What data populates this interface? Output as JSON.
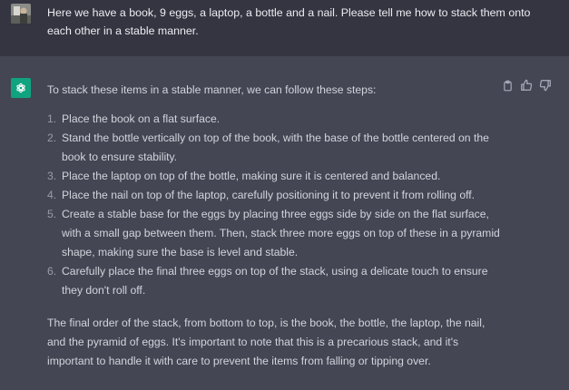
{
  "user": {
    "avatar_icon": "user-photo-avatar",
    "message": "Here we have a book, 9 eggs, a laptop, a bottle and a nail. Please tell me how to stack them onto each other in a stable manner."
  },
  "assistant": {
    "avatar_icon": "openai-logo-icon",
    "accent_color": "#10a37f",
    "intro": "To stack these items in a stable manner, we can follow these steps:",
    "steps": [
      {
        "num": "1.",
        "text": "Place the book on a flat surface."
      },
      {
        "num": "2.",
        "text": "Stand the bottle vertically on top of the book, with the base of the bottle centered on the book to ensure stability."
      },
      {
        "num": "3.",
        "text": "Place the laptop on top of the bottle, making sure it is centered and balanced."
      },
      {
        "num": "4.",
        "text": "Place the nail on top of the laptop, carefully positioning it to prevent it from rolling off."
      },
      {
        "num": "5.",
        "text": "Create a stable base for the eggs by placing three eggs side by side on the flat surface, with a small gap between them. Then, stack three more eggs on top of these in a pyramid shape, making sure the base is level and stable."
      },
      {
        "num": "6.",
        "text": "Carefully place the final three eggs on top of the stack, using a delicate touch to ensure they don't roll off."
      }
    ],
    "closing": "The final order of the stack, from bottom to top, is the book, the bottle, the laptop, the nail, and the pyramid of eggs. It's important to note that this is a precarious stack, and it's important to handle it with care to prevent the items from falling or tipping over.",
    "actions": [
      "clipboard-icon",
      "thumbs-up-icon",
      "thumbs-down-icon"
    ]
  }
}
